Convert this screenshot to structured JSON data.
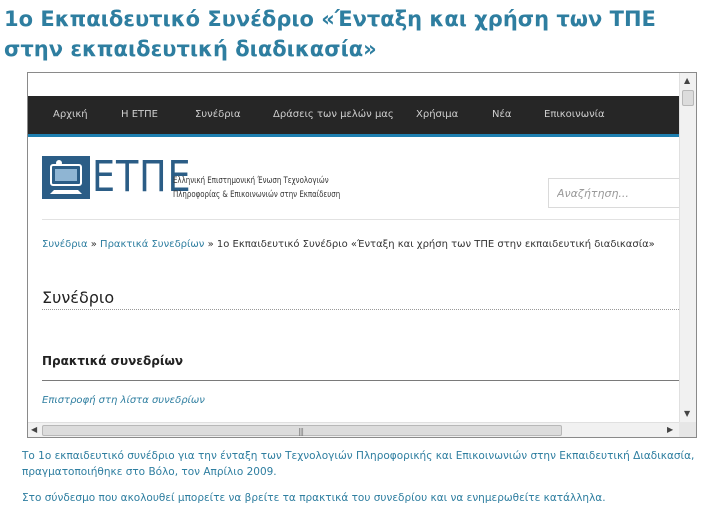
{
  "page": {
    "title": "1ο Εκπαιδευτικό Συνέδριο «Ένταξη και χρήση των ΤΠΕ στην εκπαιδευτική διαδικασία»",
    "description_1": "Το 1ο εκπαιδευτικό συνέδριο για την ένταξη των Τεχνολογιών Πληροφορικής και Επικοινωνιών στην Εκπαιδευτική Διαδικασία, πραγματοποιήθηκε στο Βόλο, τον Απρίλιο 2009.",
    "description_2": "Στο σύνδεσμο που ακολουθεί μπορείτε να βρείτε τα πρακτικά του συνεδρίου και να ενημερωθείτε κατάλληλα."
  },
  "embedded": {
    "nav": [
      "Αρχική",
      "Η ΕΤΠΕ",
      "Συνέδρια",
      "Δράσεις των μελών μας",
      "Χρήσιμα",
      "Νέα",
      "Επικοινωνία"
    ],
    "logo": {
      "letters": "ΕΤΠΕ",
      "line1": "Ελληνική Επιστημονική Ένωση Τεχνολογιών",
      "line2": "Πληροφορίας & Επικοινωνιών στην Εκπαίδευση"
    },
    "search": {
      "placeholder": "Αναζήτηση..."
    },
    "breadcrumb": {
      "crumb1": "Συνέδρια",
      "sep": "»",
      "crumb2": "Πρακτικά Συνεδρίων",
      "current": "1ο Εκπαιδευτικό Συνέδριο «Ένταξη και χρήση των ΤΠΕ στην εκπαιδευτική διαδικασία»"
    },
    "section_heading": "Συνέδριο",
    "proceedings_heading": "Πρακτικά συνεδρίων",
    "back_link": "Επιστροφή στη λίστα συνεδρίων"
  },
  "colors": {
    "accent": "#2e7ea0",
    "navbar": "#262626",
    "nav_underline": "#1e7fb0",
    "logo": "#2b5d86"
  },
  "icons": [
    "scroll-up-arrow-icon",
    "scroll-down-arrow-icon",
    "scroll-left-arrow-icon",
    "scroll-right-arrow-icon",
    "scrollbar-grip-icon"
  ]
}
